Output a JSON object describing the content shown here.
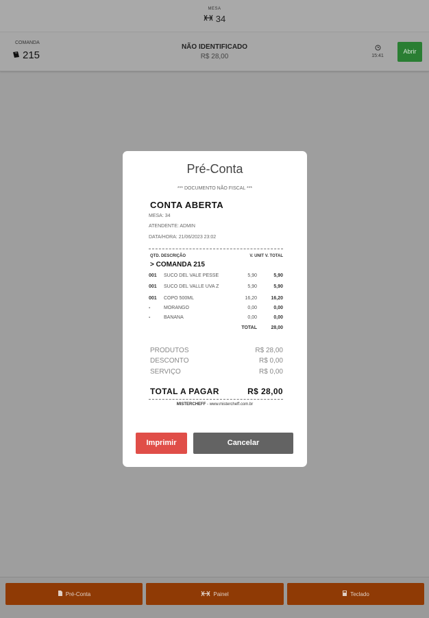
{
  "header": {
    "small_label": "MESA",
    "table_label": "34",
    "icon": "table-icon"
  },
  "comanda_card": {
    "label": "COMANDA",
    "number": "215",
    "icon": "ticket-icon",
    "customer": "NÃO IDENTIFICADO",
    "price": "R$ 28,00",
    "clock_icon": "clock-icon",
    "time": "15:41",
    "open_button": "Abrir",
    "open_button_color": "#2a7e33"
  },
  "modal": {
    "title": "Pré-Conta",
    "doc_type": "*** DOCUMENTO NÃO FISCAL ***",
    "status": "CONTA ABERTA",
    "mesa": "MESA: 34",
    "atendente": "ATENDENTE: ADMIN",
    "datahora": "DATA/HORA: 21/06/2023 23:02",
    "columns": {
      "qtd_desc": "QTD. DESCRIÇÃO",
      "unit_total": "V. UNIT V. TOTAL"
    },
    "comanda_heading": "> COMANDA 215",
    "items": [
      {
        "qty": "001",
        "desc": "SUCO DEL VALE PESSE",
        "unit": "5,90",
        "total": "5,90"
      },
      {
        "qty": "001",
        "desc": "SUCO DEL VALLE UVA Z",
        "unit": "5,90",
        "total": "5,90"
      },
      {
        "qty": "001",
        "desc": "COPO 500ML",
        "unit": "16,20",
        "total": "16,20"
      },
      {
        "qty": "-",
        "desc": "MORANGO",
        "unit": "0,00",
        "total": "0,00"
      },
      {
        "qty": "-",
        "desc": "BANANA",
        "unit": "0,00",
        "total": "0,00"
      }
    ],
    "total_label": "TOTAL",
    "total_value": "28,00",
    "summary": [
      {
        "label": "PRODUTOS",
        "value": "R$ 28,00"
      },
      {
        "label": "DESCONTO",
        "value": "R$ 0,00"
      },
      {
        "label": "SERVIÇO",
        "value": "R$ 0,00"
      }
    ],
    "pay_label": "TOTAL A PAGAR",
    "pay_value": "R$ 28,00",
    "footer_brand": "MISTERCHEFF",
    "footer_site": " - www.mistercheff.com.br",
    "print_button": "Imprimir",
    "cancel_button": "Cancelar",
    "print_color": "#e04e48",
    "cancel_color": "#636363"
  },
  "bottom_bar": {
    "buttons": [
      {
        "label": "Pré-Conta",
        "icon": "document-icon"
      },
      {
        "label": "Painel",
        "icon": "table-icon"
      },
      {
        "label": "Teclado",
        "icon": "calculator-icon"
      }
    ],
    "color": "#8f3a05"
  }
}
